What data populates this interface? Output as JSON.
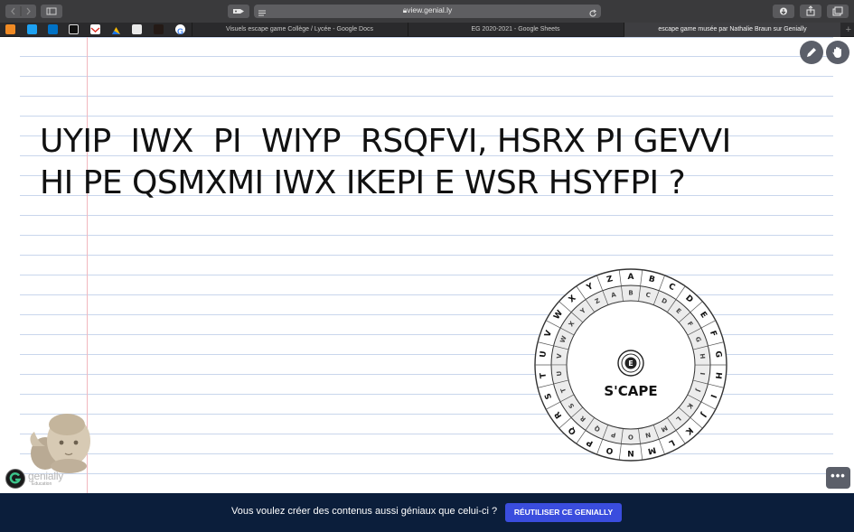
{
  "browser": {
    "url": "view.genial.ly",
    "tabs": [
      {
        "label": "Visuels escape game Collège / Lycée - Google Docs",
        "active": false
      },
      {
        "label": "EG 2020-2021 - Google Sheets",
        "active": false
      },
      {
        "label": "escape game musée par Nathalie Braun sur Genially",
        "active": true
      }
    ],
    "new_tab_label": "+",
    "bookmark_icons": [
      "blogger-icon",
      "twitter-icon",
      "outlook-icon",
      "app-icon",
      "gmail-icon",
      "drive-icon",
      "bookmark-icon",
      "dark-app-icon",
      "google-icon"
    ]
  },
  "puzzle": {
    "line1": "UYIP  IWX  PI  WIYP  RSQFVI, HSRX PI GEVVI",
    "line2": "HI PE QSMXMI IWX IKEPI E WSR HSYFPI ?"
  },
  "cipher_wheel": {
    "center_label": "S'CAPE",
    "alphabet": [
      "A",
      "B",
      "C",
      "D",
      "E",
      "F",
      "G",
      "H",
      "I",
      "J",
      "K",
      "L",
      "M",
      "N",
      "O",
      "P",
      "Q",
      "R",
      "S",
      "T",
      "U",
      "V",
      "W",
      "X",
      "Y",
      "Z"
    ]
  },
  "genially": {
    "logo_word": "genially",
    "logo_sub": "Education",
    "more_label": "•••",
    "banner_text": "Vous voulez créer des contenus aussi géniaux que celui-ci ?",
    "banner_button": "RÉUTILISER CE GENIALLY"
  },
  "colors": {
    "banner_bg": "#0b1e3b",
    "banner_button": "#3a4dde",
    "ruled_line": "#c9d6ec",
    "margin_line": "#f2b8bf"
  }
}
